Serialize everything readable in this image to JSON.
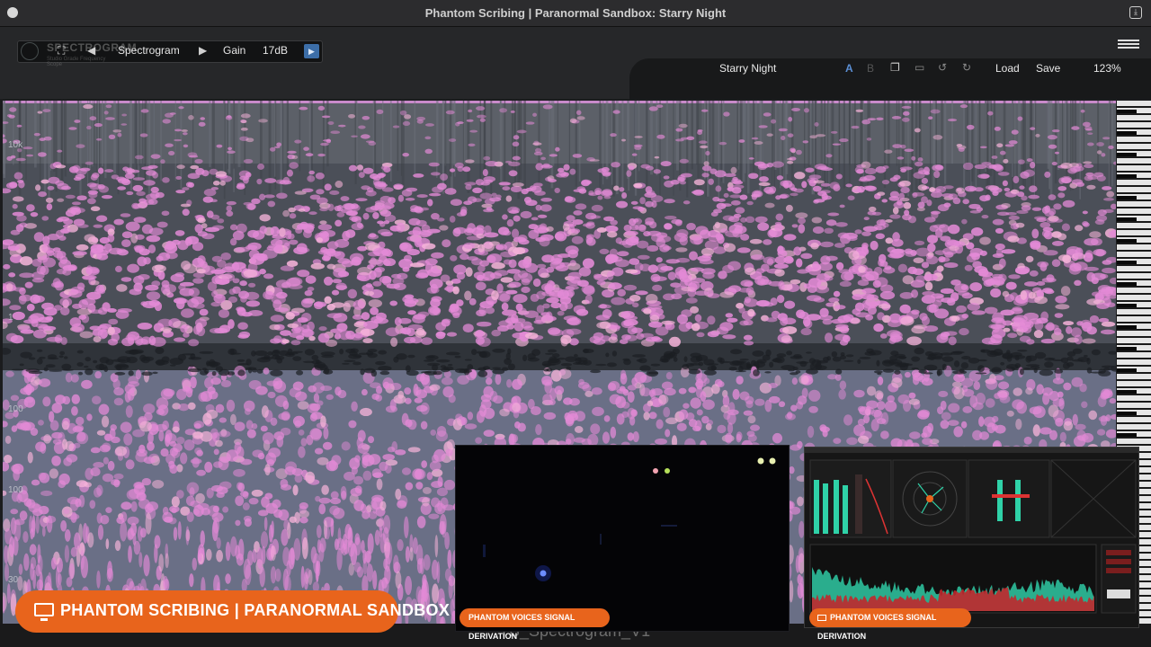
{
  "window": {
    "title": "Phantom Scribing | Paranormal Sandbox: Starry Night"
  },
  "logo": {
    "name": "SPECTROGRAM",
    "subtitle": "Studio Grade Frequency Scope"
  },
  "toolbar": {
    "mode_label": "Spectrogram",
    "gain_label": "Gain",
    "gain_value": "17dB"
  },
  "header": {
    "preset_name": "Starry Night",
    "ab_a": "A",
    "ab_b": "B",
    "load_label": "Load",
    "save_label": "Save",
    "zoom": "123%"
  },
  "spectrogram": {
    "y_labels": [
      "10k",
      "1",
      "100",
      "100",
      "30"
    ]
  },
  "footer": {
    "label": "TB_Spectrogram_V1"
  },
  "overlay": {
    "banner": "PHANTOM SCRIBING | PARANORMAL SANDBOX",
    "pill_left": "PHANTOM VOICES SIGNAL DERIVATION",
    "pill_right": "PHANTOM VOICES SIGNAL DERIVATION"
  },
  "colors": {
    "accent_orange": "#e8641c",
    "spectro_pink": "#e38ad6",
    "spectro_base": "#4a5058",
    "meter_green": "#2fd2a8",
    "play_blue": "#3c6ea8"
  },
  "icons": [
    "crop-icon",
    "chevron-left-icon",
    "chevron-right-icon",
    "play-icon",
    "copy-icon",
    "paste-icon",
    "undo-icon",
    "redo-icon",
    "menu-icon",
    "monitor-icon",
    "exit-fullscreen-icon"
  ]
}
